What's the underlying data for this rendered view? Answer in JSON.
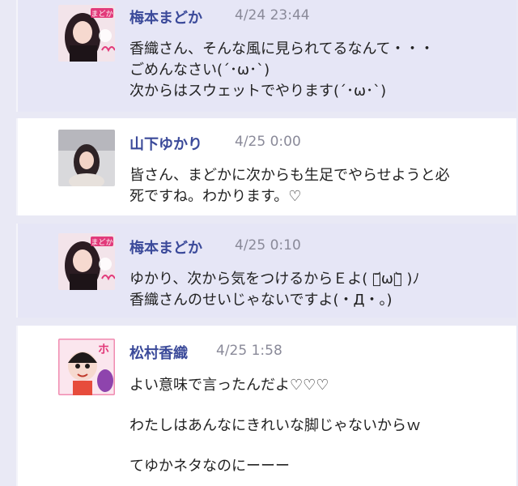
{
  "posts": [
    {
      "author": "梅本まどか",
      "time": "4/24 23:44",
      "lines": [
        "香織さん、そんな風に見られてるなんて・・・",
        "ごめんなさい(´･ω･`)",
        "次からはスウェットでやります(´･ω･`)"
      ],
      "avatar_text": "まどか"
    },
    {
      "author": "山下ゆかり",
      "time": "4/25 0:00",
      "lines": [
        "皆さん、まどかに次からも生足でやらせようと必",
        "死ですね。わかります。♡"
      ]
    },
    {
      "author": "梅本まどか",
      "time": "4/25 0:10",
      "lines": [
        "ゆかり、次から気をつけるからＥよ( ･᷄ω･᷅ )ﾉ",
        "香織さんのせいじゃないですよ(・Д・。)"
      ],
      "avatar_text": "まどか"
    },
    {
      "author": "松村香織",
      "time": "4/25 1:58",
      "lines": [
        "よい意味で言ったんだよ♡♡♡",
        "",
        "わたしはあんなにきれいな脚じゃないからｗ",
        "",
        "てゆかネタなのにーーー"
      ],
      "avatar_text": "ホ"
    }
  ]
}
